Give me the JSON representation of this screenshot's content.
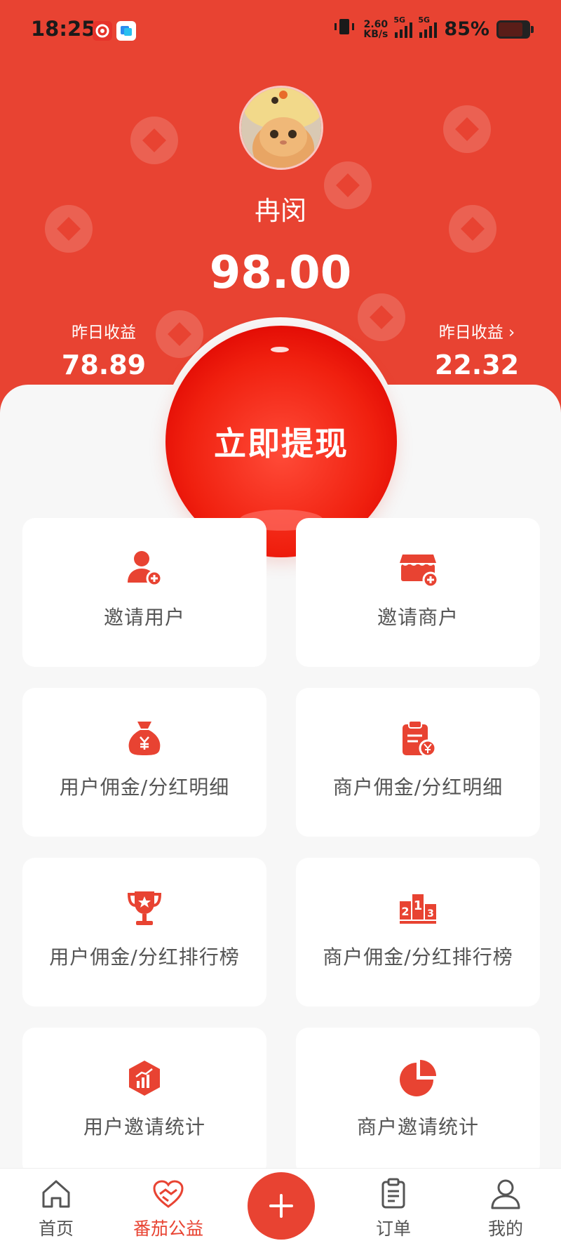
{
  "status_bar": {
    "time": "18:25",
    "net_speed_value": "2.60",
    "net_speed_unit": "KB/s",
    "network_1": "5G",
    "network_2": "5G",
    "battery": "85%"
  },
  "profile": {
    "avatar_icon": "cat-avatar",
    "name": "冉闵",
    "balance": "98.00"
  },
  "stats": {
    "left": {
      "label": "昨日收益",
      "value": "78.89"
    },
    "right": {
      "label": "昨日收益",
      "value": "22.32",
      "chevron": "›"
    }
  },
  "withdraw_button": {
    "label": "立即提现"
  },
  "cards": [
    {
      "label": "邀请用户",
      "icon": "user-add-icon"
    },
    {
      "label": "邀请商户",
      "icon": "store-add-icon"
    },
    {
      "label": "用户佣金/分红明细",
      "icon": "money-bag-icon"
    },
    {
      "label": "商户佣金/分红明细",
      "icon": "clipboard-yen-icon"
    },
    {
      "label": "用户佣金/分红排行榜",
      "icon": "trophy-icon"
    },
    {
      "label": "商户佣金/分红排行榜",
      "icon": "podium-icon"
    },
    {
      "label": "用户邀请统计",
      "icon": "chart-hexagon-icon"
    },
    {
      "label": "商户邀请统计",
      "icon": "pie-chart-icon"
    }
  ],
  "tabbar": {
    "home": "首页",
    "charity": "番茄公益",
    "orders": "订单",
    "mine": "我的",
    "active": "charity"
  },
  "colors": {
    "accent": "#e84332",
    "background": "#f7f7f7"
  }
}
